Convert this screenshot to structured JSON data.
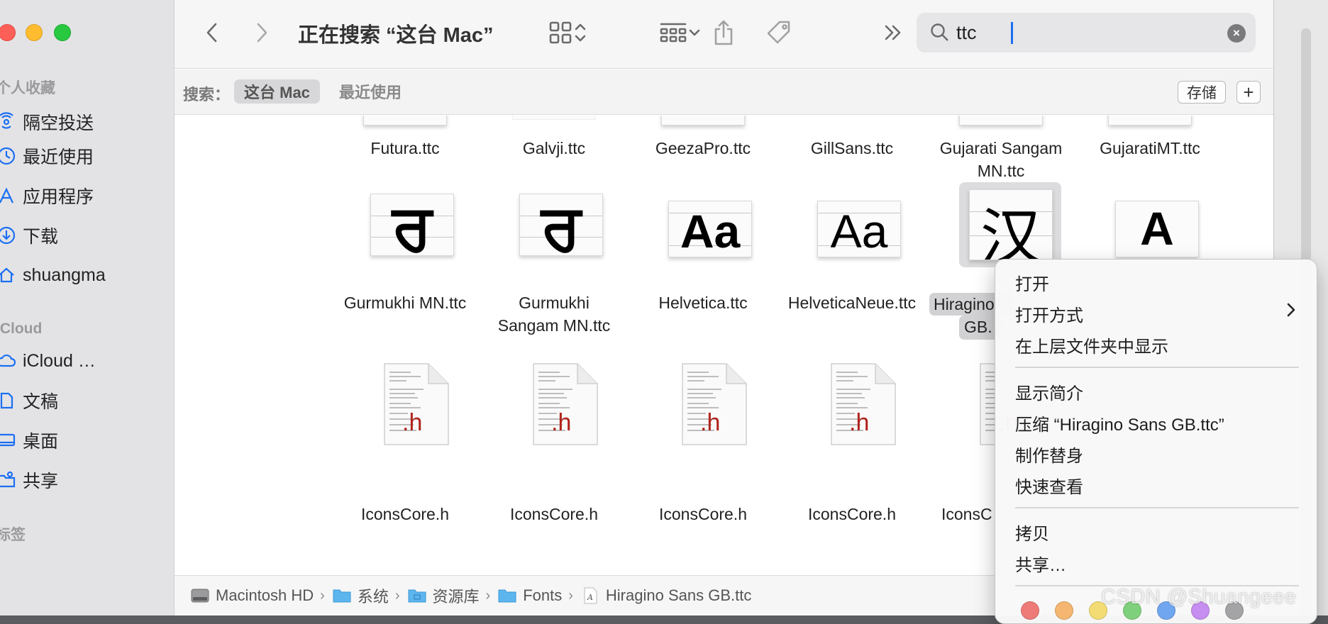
{
  "window": {
    "title": "正在搜索 “这台 Mac”"
  },
  "sidebar": {
    "favorites_header": "个人收藏",
    "favorites": [
      {
        "label": "隔空投送",
        "icon": "airdrop-icon"
      },
      {
        "label": "最近使用",
        "icon": "clock-icon"
      },
      {
        "label": "应用程序",
        "icon": "applications-icon"
      },
      {
        "label": "下载",
        "icon": "download-icon"
      },
      {
        "label": "shuangma",
        "icon": "home-icon"
      }
    ],
    "icloud_header": "iCloud",
    "icloud": [
      {
        "label": "iCloud …",
        "icon": "cloud-icon"
      },
      {
        "label": "文稿",
        "icon": "document-icon"
      },
      {
        "label": "桌面",
        "icon": "desktop-icon"
      },
      {
        "label": "共享",
        "icon": "shared-folder-icon"
      }
    ],
    "tags_header": "标签"
  },
  "search": {
    "value": "ttc"
  },
  "scopebar": {
    "label": "搜索：",
    "active": "这台 Mac",
    "inactive": "最近使用",
    "save": "存储",
    "add": "+"
  },
  "files": {
    "row1": [
      "Futura.ttc",
      "Galvji.ttc",
      "GeezaPro.ttc",
      "GillSans.ttc",
      "Gujarati Sangam MN.ttc",
      "GujaratiMT.ttc"
    ],
    "row2": [
      "Gurmukhi MN.ttc",
      "Gurmukhi Sangam MN.ttc",
      "Helvetica.ttc",
      "HelveticaNeue.ttc",
      "Hiragino Sans GB.ttc",
      ""
    ],
    "row2_selected_visible": "Hiragino",
    "row2_selected_visible2": "GB.",
    "row2_glyphs": [
      "ਰ",
      "ਰ",
      "Aa",
      "Aa",
      "汉",
      "A"
    ],
    "row3": [
      "IconsCore.h",
      "IconsCore.h",
      "IconsCore.h",
      "IconsCore.h",
      "IconsC"
    ],
    "h_ext": ".h"
  },
  "pathbar": [
    {
      "label": "Macintosh HD",
      "icon": "hard-drive-icon"
    },
    {
      "label": "系统",
      "icon": "folder-icon"
    },
    {
      "label": "资源库",
      "icon": "library-folder-icon"
    },
    {
      "label": "Fonts",
      "icon": "folder-icon"
    },
    {
      "label": "Hiragino Sans GB.ttc",
      "icon": "font-file-icon"
    }
  ],
  "context_menu": {
    "items": [
      "打开",
      "打开方式",
      "在上层文件夹中显示",
      "显示简介",
      "压缩 “Hiragino Sans GB.ttc”",
      "制作替身",
      "快速查看",
      "拷贝",
      "共享…"
    ],
    "tag_colors": [
      "#ee7b78",
      "#f4b670",
      "#f3dc73",
      "#7fd07c",
      "#70a6f0",
      "#c68ef0",
      "#a4a4a6"
    ]
  },
  "watermark": "CSDN @Shuangeee",
  "colors": {
    "accent": "#1b6ff2",
    "h_ext": "#b0231c"
  }
}
